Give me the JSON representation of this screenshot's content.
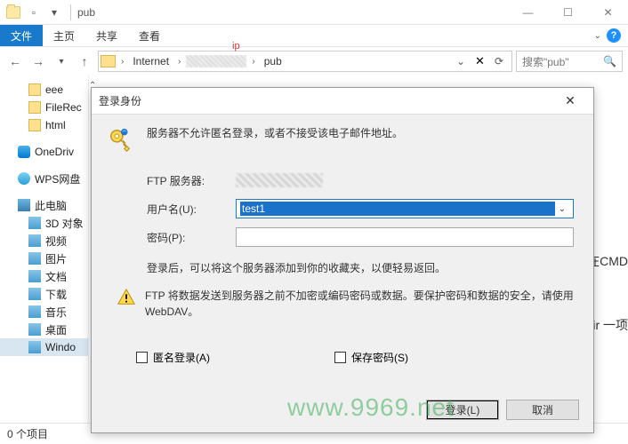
{
  "window": {
    "title": "pub",
    "watermark": "www.9969.net"
  },
  "ribbon": {
    "file": "文件",
    "home": "主页",
    "share": "共享",
    "view": "查看"
  },
  "address": {
    "ip_marker": "ip",
    "seg1": "Internet",
    "seg2": "pub",
    "search_placeholder": "搜索\"pub\""
  },
  "sidebar": {
    "items": [
      {
        "label": "eee",
        "icon": "folder"
      },
      {
        "label": "FileRec",
        "icon": "folder"
      },
      {
        "label": "html",
        "icon": "folder"
      },
      {
        "label": "OneDriv",
        "icon": "onedrive"
      },
      {
        "label": "WPS网盘",
        "icon": "wps"
      },
      {
        "label": "此电脑",
        "icon": "pc"
      },
      {
        "label": "3D 对象",
        "icon": "sub"
      },
      {
        "label": "视频",
        "icon": "sub"
      },
      {
        "label": "图片",
        "icon": "sub"
      },
      {
        "label": "文档",
        "icon": "sub"
      },
      {
        "label": "下载",
        "icon": "sub"
      },
      {
        "label": "音乐",
        "icon": "sub"
      },
      {
        "label": "桌面",
        "icon": "sub"
      },
      {
        "label": "Windo",
        "icon": "sub"
      }
    ]
  },
  "statusbar": {
    "text": "0 个项目"
  },
  "dialog": {
    "title": "登录身份",
    "message": "服务器不允许匿名登录，或者不接受该电子邮件地址。",
    "ftp_server_label": "FTP 服务器:",
    "username_label": "用户名(U):",
    "username_value": "test1",
    "password_label": "密码(P):",
    "password_value": "",
    "note": "登录后，可以将这个服务器添加到你的收藏夹，以便轻易返回。",
    "warning": "FTP 将数据发送到服务器之前不加密或编码密码或数据。要保护密码和数据的安全，请使用 WebDAV。",
    "anon_label": "匿名登录(A)",
    "save_pw_label": "保存密码(S)",
    "login_btn": "登录(L)",
    "cancel_btn": "取消"
  },
  "background": {
    "line1": "是在CMD",
    "line2": "_dir 一项"
  }
}
